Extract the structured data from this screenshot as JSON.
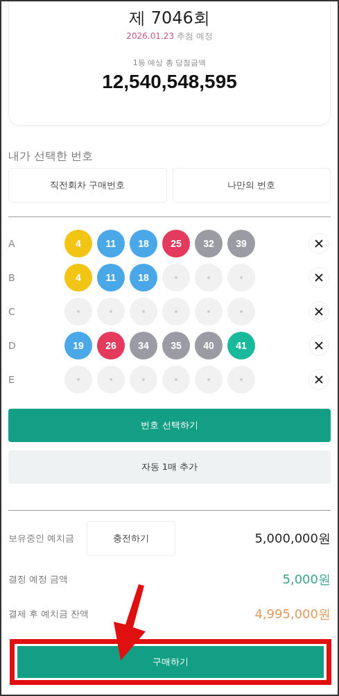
{
  "draw": {
    "round": "제 7046회",
    "date": "2026.01.23",
    "date_suffix": "추첨 예정",
    "prize_label": "1등 예상 총 당첨금액",
    "prize_amount": "12,540,548,595"
  },
  "my_numbers": {
    "title": "내가 선택한 번호",
    "tabs": [
      {
        "label": "직전회차 구매번호"
      },
      {
        "label": "나만의 번호"
      }
    ],
    "games": [
      {
        "label": "A",
        "balls": [
          {
            "kind": "number",
            "number": "4",
            "color": "#f2c413"
          },
          {
            "kind": "number",
            "number": "11",
            "color": "#4aa8e8"
          },
          {
            "kind": "number",
            "number": "18",
            "color": "#4aa8e8"
          },
          {
            "kind": "number",
            "number": "25",
            "color": "#e43a5e"
          },
          {
            "kind": "number",
            "number": "32",
            "color": "#9b9ba3"
          },
          {
            "kind": "number",
            "number": "39",
            "color": "#9b9ba3"
          }
        ]
      },
      {
        "label": "B",
        "balls": [
          {
            "kind": "number",
            "number": "4",
            "color": "#f2c413"
          },
          {
            "kind": "number",
            "number": "11",
            "color": "#4aa8e8"
          },
          {
            "kind": "number",
            "number": "18",
            "color": "#4aa8e8"
          },
          {
            "kind": "empty"
          },
          {
            "kind": "empty"
          },
          {
            "kind": "empty"
          }
        ]
      },
      {
        "label": "C",
        "balls": [
          {
            "kind": "empty"
          },
          {
            "kind": "empty"
          },
          {
            "kind": "empty"
          },
          {
            "kind": "empty"
          },
          {
            "kind": "empty"
          },
          {
            "kind": "empty"
          }
        ]
      },
      {
        "label": "D",
        "balls": [
          {
            "kind": "number",
            "number": "19",
            "color": "#4aa8e8"
          },
          {
            "kind": "number",
            "number": "26",
            "color": "#e43a5e"
          },
          {
            "kind": "number",
            "number": "34",
            "color": "#9b9ba3"
          },
          {
            "kind": "number",
            "number": "35",
            "color": "#9b9ba3"
          },
          {
            "kind": "number",
            "number": "40",
            "color": "#9b9ba3"
          },
          {
            "kind": "number",
            "number": "41",
            "color": "#1ab99c"
          }
        ]
      },
      {
        "label": "E",
        "balls": [
          {
            "kind": "empty"
          },
          {
            "kind": "empty"
          },
          {
            "kind": "empty"
          },
          {
            "kind": "empty"
          },
          {
            "kind": "empty"
          },
          {
            "kind": "empty"
          }
        ]
      }
    ],
    "select_button": "번호 선택하기",
    "auto_button": "자동 1매 추가"
  },
  "payment": {
    "balance_label": "보유중인 예치금",
    "charge_button": "충전하기",
    "balance": "5,000,000원",
    "amount_label": "결정 예정 금액",
    "amount": "5,000원",
    "remaining_label": "결제 후 예치금 잔액",
    "remaining": "4,995,000원",
    "buy_button": "구매하기"
  }
}
